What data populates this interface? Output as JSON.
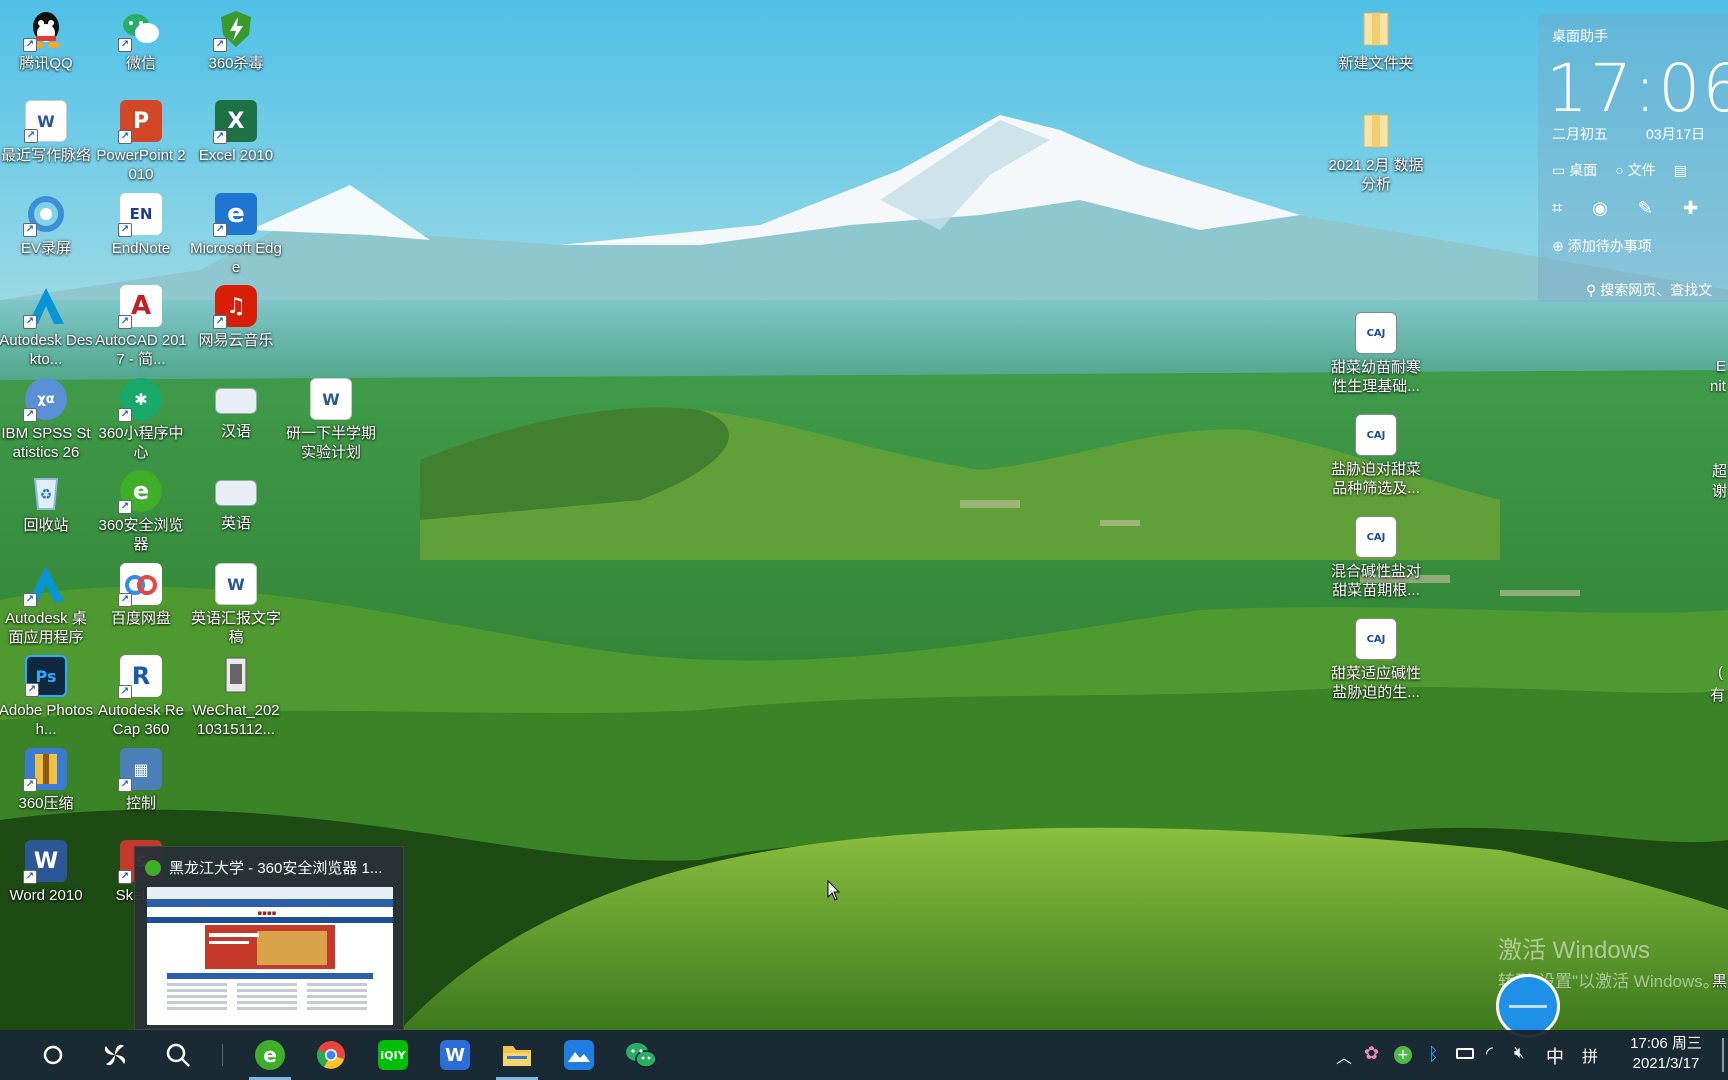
{
  "desktop_icons": [
    {
      "name": "qq",
      "label": "腾讯QQ",
      "icon": "qq-icon",
      "color": "#111111"
    },
    {
      "name": "wechat",
      "label": "微信",
      "icon": "wechat-icon",
      "color": "#2aae67"
    },
    {
      "name": "360-antivirus",
      "label": "360杀毒",
      "icon": "shield-icon",
      "color": "#3b9a2e"
    },
    {
      "name": "recent-writing",
      "label": "最近写作脉络",
      "icon": "word-doc-icon",
      "color": "#2b5797"
    },
    {
      "name": "powerpoint",
      "label": "PowerPoint 2010",
      "icon": "powerpoint-icon",
      "color": "#d24726"
    },
    {
      "name": "excel",
      "label": "Excel 2010",
      "icon": "excel-icon",
      "color": "#1e7145"
    },
    {
      "name": "ev-recorder",
      "label": "EV录屏",
      "icon": "ev-recorder-icon",
      "color": "#3a8fd8"
    },
    {
      "name": "endnote",
      "label": "EndNote",
      "icon": "endnote-icon",
      "color": "#1c3f94"
    },
    {
      "name": "edge",
      "label": "Microsoft Edge",
      "icon": "edge-icon",
      "color": "#1f76d2"
    },
    {
      "name": "autodesk-desktop",
      "label": "Autodesk Deskto...",
      "icon": "autodesk-icon",
      "color": "#0696d7"
    },
    {
      "name": "autocad",
      "label": "AutoCAD 2017 - 简...",
      "icon": "autocad-icon",
      "color": "#c0202a"
    },
    {
      "name": "netease-music",
      "label": "网易云音乐",
      "icon": "music-icon",
      "color": "#d81e06"
    },
    {
      "name": "spss",
      "label": "IBM SPSS Statistics 26",
      "icon": "spss-icon",
      "color": "#5a8fd6"
    },
    {
      "name": "360-miniprogram",
      "label": "360小程序中心",
      "icon": "miniprogram-icon",
      "color": "#18a96b"
    },
    {
      "name": "chinese",
      "label": "汉语",
      "icon": "image-file-icon",
      "color": "#cfd8e0"
    },
    {
      "name": "semester-plan",
      "label": "研一下半学期实验计划",
      "icon": "word-doc-icon",
      "color": "#2b5797"
    },
    {
      "name": "recycle-bin",
      "label": "回收站",
      "icon": "recycle-bin-icon",
      "color": "#9fc8e8"
    },
    {
      "name": "360-browser",
      "label": "360安全浏览器",
      "icon": "browser-icon",
      "color": "#3fae29"
    },
    {
      "name": "english",
      "label": "英语",
      "icon": "image-file-icon",
      "color": "#cfd8e0"
    },
    {
      "name": "autodesk-desktop-app",
      "label": "Autodesk 桌面应用程序",
      "icon": "autodesk-icon",
      "color": "#0696d7"
    },
    {
      "name": "baidu-netdisk",
      "label": "百度网盘",
      "icon": "cloud-icon",
      "color": "#2f8cf0"
    },
    {
      "name": "english-report",
      "label": "英语汇报文字稿",
      "icon": "word-doc-icon",
      "color": "#2b5797"
    },
    {
      "name": "photoshop",
      "label": "Adobe Photosh...",
      "icon": "photoshop-icon",
      "color": "#0f2940"
    },
    {
      "name": "recap",
      "label": "Autodesk ReCap 360",
      "icon": "recap-icon",
      "color": "#1c5aa6"
    },
    {
      "name": "wechat-file",
      "label": "WeChat_202 10315112...",
      "icon": "file-icon",
      "color": "#e0e0e0"
    },
    {
      "name": "360-zip",
      "label": "360压缩",
      "icon": "zip-icon",
      "color": "#3b7bd4"
    },
    {
      "name": "control-panel",
      "label": "控制",
      "icon": "control-panel-icon",
      "color": "#4a7fb8"
    },
    {
      "name": "word",
      "label": "Word 2010",
      "icon": "word-icon",
      "color": "#2b5797"
    },
    {
      "name": "sketchup",
      "label": "Sket 20",
      "icon": "sketchup-icon",
      "color": "#c0392b"
    },
    {
      "name": "new-folder",
      "label": "新建文件夹",
      "icon": "folder-icon",
      "color": "#f3d37c"
    },
    {
      "name": "data-analysis-folder",
      "label": "2021.2月 数据分析",
      "icon": "folder-icon",
      "color": "#f3d37c"
    },
    {
      "name": "caj-1",
      "label": "甜菜幼苗耐寒性生理基础...",
      "icon": "caj-file-icon",
      "color": "#1c4aa0"
    },
    {
      "name": "caj-2",
      "label": "盐胁迫对甜菜品种筛选及...",
      "icon": "caj-file-icon",
      "color": "#1c4aa0"
    },
    {
      "name": "caj-3",
      "label": "混合碱性盐对甜菜苗期根...",
      "icon": "caj-file-icon",
      "color": "#1c4aa0"
    },
    {
      "name": "caj-4",
      "label": "甜菜适应碱性盐胁迫的生...",
      "icon": "caj-file-icon",
      "color": "#1c4aa0"
    }
  ],
  "edge_labels": [
    "E",
    "nit",
    "超",
    "谢",
    "(",
    "有",
    "黒"
  ],
  "assistant": {
    "title": "桌面助手",
    "time": "17:06",
    "lunar_date": "二月初五",
    "date": "03月17日",
    "tabs": [
      "桌面",
      "文件",
      ""
    ],
    "add_todo": "添加待办事项",
    "search_placeholder": "搜索网页、查找文"
  },
  "preview": {
    "title": "黑龙江大学 - 360安全浏览器 1...",
    "icon": "browser-icon"
  },
  "watermark": {
    "line1": "激活 Windows",
    "line2": "转到\"设置\"以激活 Windows。"
  },
  "taskbar": {
    "pinned": [
      {
        "name": "cortana",
        "icon": "circle-icon"
      },
      {
        "name": "task-view",
        "icon": "pinwheel-icon"
      },
      {
        "name": "search",
        "icon": "search-icon"
      },
      {
        "name": "360-browser",
        "icon": "browser-icon",
        "color": "#3fae29",
        "active": true
      },
      {
        "name": "chrome",
        "icon": "chrome-icon",
        "color": "#e8453c"
      },
      {
        "name": "iqiyi",
        "icon": "iqiyi-icon",
        "color": "#00be06",
        "text": "iQIY"
      },
      {
        "name": "wps",
        "icon": "wps-icon",
        "color": "#2b6fd6",
        "text": "W"
      },
      {
        "name": "file-explorer",
        "icon": "folder-icon",
        "color": "#f1c24f",
        "active": true
      },
      {
        "name": "lanxin",
        "icon": "mountain-icon",
        "color": "#1f7ee0"
      },
      {
        "name": "wechat",
        "icon": "wechat-icon",
        "color": "#2aae67"
      }
    ],
    "tray": {
      "ime_lang": "中",
      "ime_mode": "拼",
      "time": "17:06 周三",
      "date": "2021/3/17"
    }
  }
}
